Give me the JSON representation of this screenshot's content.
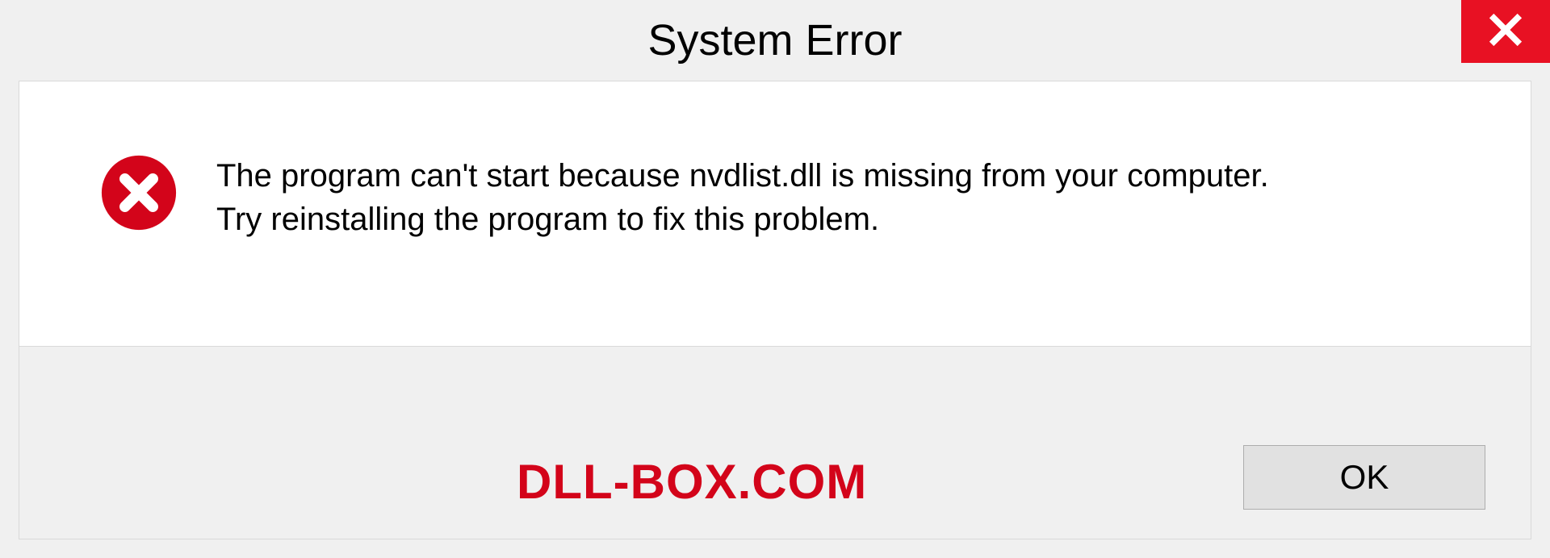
{
  "dialog": {
    "title": "System Error",
    "message_line1": "The program can't start because nvdlist.dll is missing from your computer.",
    "message_line2": "Try reinstalling the program to fix this problem.",
    "ok_label": "OK"
  },
  "branding": {
    "watermark": "DLL-BOX.COM"
  },
  "colors": {
    "close_bg": "#e81123",
    "error_icon": "#d3041a",
    "watermark": "#d3041a"
  }
}
